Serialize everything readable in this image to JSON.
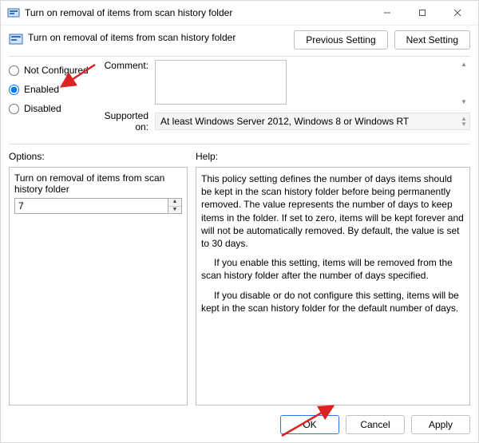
{
  "window": {
    "title": "Turn on removal of items from scan history folder"
  },
  "header": {
    "policy_name": "Turn on removal of items from scan history folder",
    "nav": {
      "prev": "Previous Setting",
      "next": "Next Setting"
    }
  },
  "state": {
    "options": {
      "not_configured": "Not Configured",
      "enabled": "Enabled",
      "disabled": "Disabled"
    },
    "selected": "enabled",
    "comment_label": "Comment:",
    "comment_value": "",
    "supported_label": "Supported on:",
    "supported_value": "At least Windows Server 2012, Windows 8 or Windows RT"
  },
  "lower": {
    "options_label": "Options:",
    "help_label": "Help:",
    "option_item_label": "Turn on removal of items from scan history folder",
    "option_item_value": "7",
    "help_p1": "This policy setting defines the number of days items should be kept in the scan history folder before being permanently removed. The value represents the number of days to keep items in the folder. If set to zero, items will be kept forever and will not be automatically removed. By default, the value is set to 30 days.",
    "help_p2": "If you enable this setting, items will be removed from the scan history folder after the number of days specified.",
    "help_p3": "If you disable or do not configure this setting, items will be kept in the scan history folder for the default number of days."
  },
  "footer": {
    "ok": "OK",
    "cancel": "Cancel",
    "apply": "Apply"
  },
  "annotation": {
    "arrow_color": "#d22"
  }
}
